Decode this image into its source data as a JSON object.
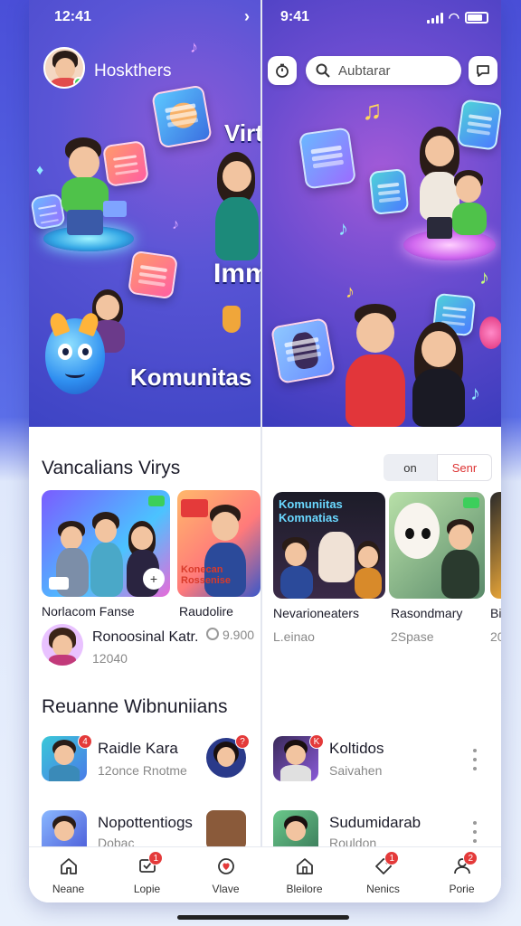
{
  "left_phone": {
    "status": {
      "time": "12:41"
    },
    "profile": {
      "name": "Hoskthers"
    },
    "hero": {
      "title_1": "Virtual",
      "title_2": "Imm",
      "title_3": "Komunitas"
    },
    "section_title": "Vancalians Virys",
    "cards": [
      {
        "label": "Norlacom Fanse"
      },
      {
        "label": "Raudolire"
      },
      {
        "label": "Konecan Rossenise"
      }
    ],
    "creator": {
      "name": "Ronoosinal Katr.",
      "meta": "12040",
      "count": "9.900"
    },
    "section2_title": "Reuanne Wibnuniians",
    "list": [
      {
        "title": "Raidle Kara",
        "sub": "12once Rnotme",
        "badge": "4"
      },
      {
        "title": "Nopottentiogs",
        "sub": "Dobac",
        "badge": ""
      }
    ]
  },
  "right_phone": {
    "status": {
      "time": "9:41"
    },
    "search": {
      "placeholder": "Aubtarar"
    },
    "toggle": {
      "off": "on",
      "on": "Senr"
    },
    "cards": [
      {
        "label": "Nevarioneaters",
        "sub": "L.einao",
        "poster": "Komuniitas Komnatias"
      },
      {
        "label": "Rasondmary",
        "sub": "2Spase"
      },
      {
        "label": "Bi",
        "sub": "20"
      }
    ],
    "list": [
      {
        "title": "Koltidos",
        "sub": "Saivahen",
        "badge": "K"
      },
      {
        "title": "Sudumidarab",
        "sub": "Rouldon",
        "badge": ""
      }
    ]
  },
  "bottom_nav": [
    {
      "label": "Neane",
      "icon": "home-icon",
      "badge": ""
    },
    {
      "label": "Lopie",
      "icon": "chat-icon",
      "badge": "1"
    },
    {
      "label": "Vlave",
      "icon": "heart-icon",
      "badge": ""
    },
    {
      "label": "Bleilore",
      "icon": "building-icon",
      "badge": ""
    },
    {
      "label": "Nenics",
      "icon": "tag-icon",
      "badge": "1"
    },
    {
      "label": "Porie",
      "icon": "profile-icon",
      "badge": "2"
    }
  ]
}
